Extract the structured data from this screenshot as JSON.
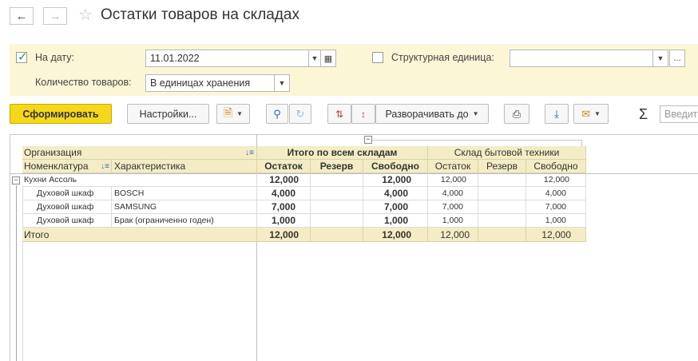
{
  "window": {
    "title": "Остатки товаров на складах"
  },
  "filters": {
    "date_label": "На дату:",
    "date_value": "11.01.2022",
    "date_checked": true,
    "struct_label": "Структурная единица:",
    "struct_value": "",
    "struct_checked": false,
    "qty_label": "Количество товаров:",
    "qty_value": "В единицах хранения"
  },
  "toolbar": {
    "generate_label": "Сформировать",
    "settings_label": "Настройки...",
    "expand_label": "Разворачивать до",
    "search_placeholder": "Введите"
  },
  "report": {
    "header": {
      "organization": "Организация",
      "nomenclature": "Номенклатура",
      "characteristic": "Характеристика",
      "group_total": "Итого по всем складам",
      "group_warehouse": "Склад бытовой техники",
      "col_remainder": "Остаток",
      "col_reserve": "Резерв",
      "col_free": "Свободно"
    },
    "group_row": {
      "name": "Кухни Ассоль",
      "total_remainder": "12,000",
      "total_reserve": "",
      "total_free": "12,000",
      "wh_remainder": "12,000",
      "wh_reserve": "",
      "wh_free": "12,000"
    },
    "rows": [
      {
        "name": "Духовой шкаф",
        "characteristic": "BOSCH",
        "total_remainder": "4,000",
        "total_reserve": "",
        "total_free": "4,000",
        "wh_remainder": "4,000",
        "wh_reserve": "",
        "wh_free": "4,000"
      },
      {
        "name": "Духовой шкаф",
        "characteristic": "SAMSUNG",
        "total_remainder": "7,000",
        "total_reserve": "",
        "total_free": "7,000",
        "wh_remainder": "7,000",
        "wh_reserve": "",
        "wh_free": "7,000"
      },
      {
        "name": "Духовой шкаф",
        "characteristic": "Брак (ограниченно годен)",
        "total_remainder": "1,000",
        "total_reserve": "",
        "total_free": "1,000",
        "wh_remainder": "1,000",
        "wh_reserve": "",
        "wh_free": "1,000"
      }
    ],
    "totals": {
      "label": "Итого",
      "total_remainder": "12,000",
      "total_reserve": "",
      "total_free": "12,000",
      "wh_remainder": "12,000",
      "wh_reserve": "",
      "wh_free": "12,000"
    }
  }
}
